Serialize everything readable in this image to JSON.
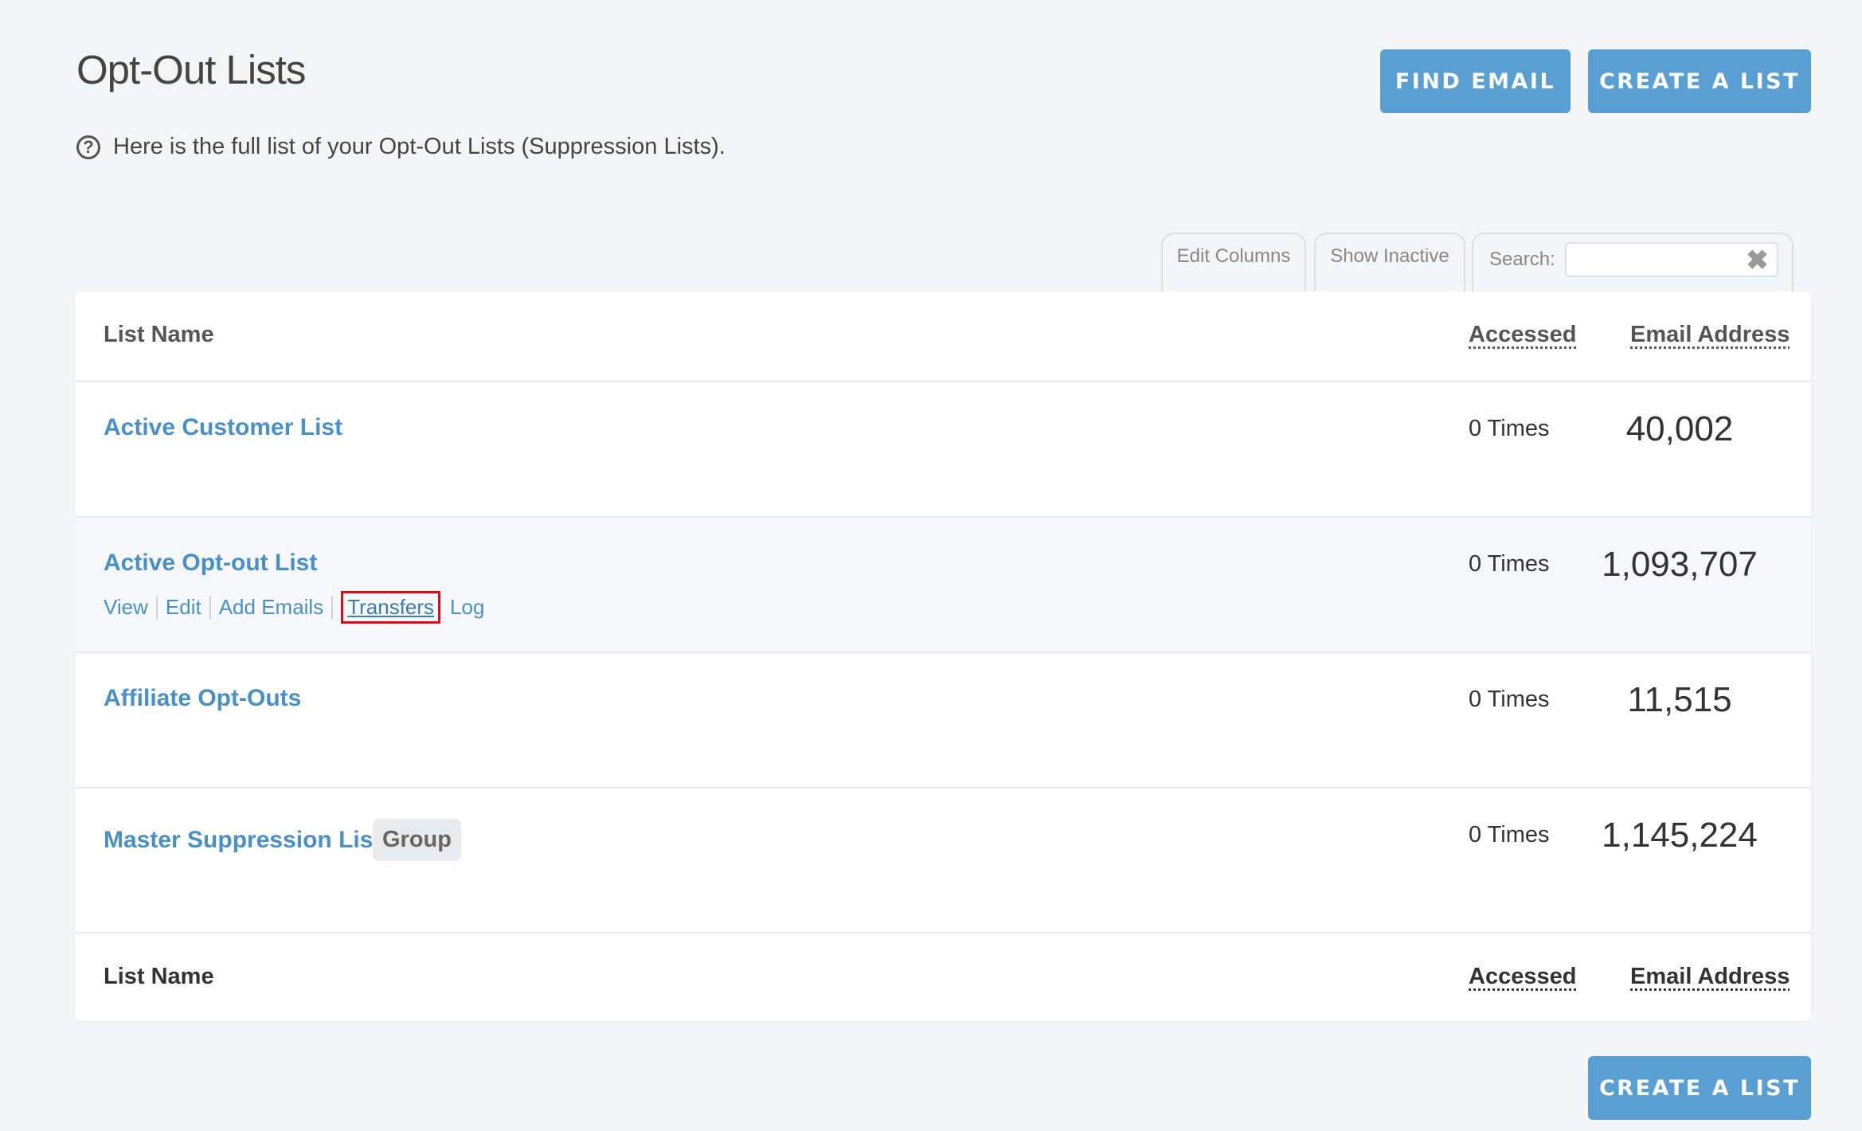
{
  "page": {
    "title": "Opt-Out Lists",
    "help_text": "Here is the full list of your Opt-Out Lists (Suppression Lists)."
  },
  "buttons": {
    "find_email": "FIND EMAIL",
    "create_list": "CREATE A LIST",
    "create_list_bottom": "CREATE A LIST"
  },
  "toolbar": {
    "edit_columns": "Edit Columns",
    "show_inactive": "Show Inactive",
    "search_label": "Search:",
    "search_value": ""
  },
  "table": {
    "header": {
      "list_name": "List Name",
      "accessed": "Accessed",
      "email_address": "Email Address"
    },
    "footer": {
      "list_name": "List Name",
      "accessed": "Accessed",
      "email_address": "Email Address"
    },
    "rows": [
      {
        "name": "Active Customer List",
        "accessed": "0 Times",
        "count": "40,002"
      },
      {
        "name": "Active Opt-out List",
        "accessed": "0 Times",
        "count": "1,093,707",
        "actions": [
          "View",
          "Edit",
          "Add Emails",
          "Transfers",
          "Log"
        ]
      },
      {
        "name": "Affiliate Opt-Outs",
        "accessed": "0 Times",
        "count": "11,515"
      },
      {
        "name": "Master Suppression List",
        "accessed": "0 Times",
        "count": "1,145,224",
        "badge": "Group"
      }
    ]
  },
  "colors": {
    "accent": "#5a9fd4",
    "link": "#4a90c8",
    "highlight_border": "#d9101a"
  }
}
